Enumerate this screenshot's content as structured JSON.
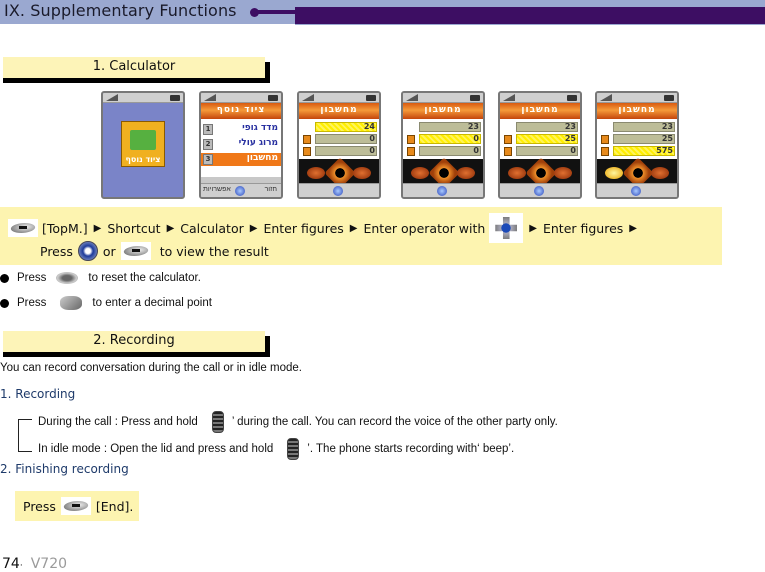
{
  "header": {
    "title": "IX. Supplementary Functions",
    "accent_color": "#3d0e63",
    "band_color": "#9aa8d0"
  },
  "sections": [
    {
      "id": "calculator",
      "title": "1. Calculator"
    },
    {
      "id": "recording",
      "title": "2. Recording"
    }
  ],
  "calculator": {
    "screens": [
      {
        "type": "menu",
        "label": "ציוד נוסף"
      },
      {
        "type": "list",
        "title": "ציוד נוסף",
        "items": [
          {
            "num": "1",
            "label": "מדד גופי"
          },
          {
            "num": "2",
            "label": "מרוג עולי"
          },
          {
            "num": "3",
            "label": "מחשבון",
            "selected": true
          }
        ],
        "soft_left": "אפשרויות",
        "soft_right": "חזור"
      },
      {
        "type": "calc",
        "title": "מחשבון",
        "rows": [
          "24",
          "0",
          "0"
        ],
        "highlight": 0,
        "ok_on": false
      },
      {
        "type": "calc",
        "title": "מחשבון",
        "rows": [
          "23",
          "0",
          "0"
        ],
        "highlight": 1,
        "ok_on": false
      },
      {
        "type": "calc",
        "title": "מחשבון",
        "rows": [
          "23",
          "25",
          "0"
        ],
        "highlight": 1,
        "ok_on": false
      },
      {
        "type": "calc",
        "title": "מחשבון",
        "rows": [
          "23",
          "25",
          "575"
        ],
        "highlight": 2,
        "ok_on": true
      }
    ],
    "instruction": {
      "softkey_icon": "menu-softkey-icon",
      "path": [
        "[TopM.]",
        "Shortcut",
        "Calculator",
        "Enter figures",
        "Enter operator with",
        "Enter figures"
      ],
      "line2_press": "Press",
      "line2_or": "or",
      "line2_result": "to view the result"
    },
    "tips": [
      {
        "prefix": "Press",
        "key_icon": "clear-key-icon",
        "text": "to reset the calculator."
      },
      {
        "prefix": "Press",
        "key_icon": "star-key-icon",
        "text": "to enter a decimal point"
      }
    ]
  },
  "recording": {
    "intro": "You can record conversation during the call or in idle mode.",
    "sub1": "1. Recording",
    "during_call_a": "During the call : Press and hold",
    "during_call_b": "’ during the call. You can record the voice of the other party only.",
    "idle_a": "In idle mode : Open the lid and press and hold",
    "idle_b": "’. The phone starts recording with‘  beep’.",
    "sub2": "2. Finishing recording",
    "finish_press": "Press",
    "finish_end": "[End]."
  },
  "footer": {
    "page_number": "74",
    "separator": "·",
    "model": "V720"
  }
}
